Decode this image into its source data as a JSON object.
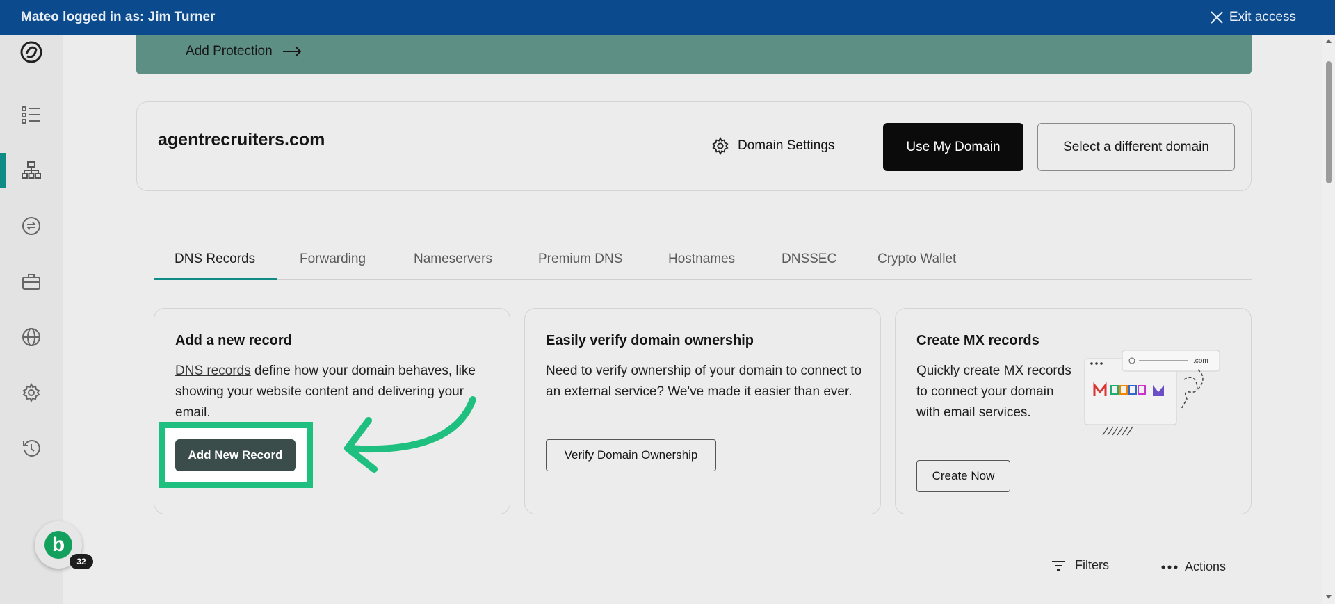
{
  "topbar": {
    "logged_in_text": "Mateo logged in as: Jim Turner",
    "exit_label": "Exit access"
  },
  "sidebar": {
    "items": [
      "logo-icon",
      "list-icon",
      "dns-icon",
      "transfer-icon",
      "briefcase-icon",
      "globe-icon",
      "gear-icon",
      "history-icon"
    ],
    "active": "dns-icon"
  },
  "banner": {
    "link_label": "Add Protection"
  },
  "domain": {
    "name": "agentrecruiters.com",
    "settings_label": "Domain Settings",
    "use_label": "Use My Domain",
    "select_label": "Select a different domain"
  },
  "tabs": [
    {
      "label": "DNS Records",
      "active": true
    },
    {
      "label": "Forwarding"
    },
    {
      "label": "Nameservers"
    },
    {
      "label": "Premium DNS"
    },
    {
      "label": "Hostnames"
    },
    {
      "label": "DNSSEC"
    },
    {
      "label": "Crypto Wallet"
    }
  ],
  "cards": {
    "add_record": {
      "title": "Add a new record",
      "link_text": "DNS records",
      "body": " define how your domain behaves, like showing your website content and delivering your email.",
      "button": "Add New Record"
    },
    "verify": {
      "title": "Easily verify domain ownership",
      "body": "Need to verify ownership of your domain to connect to an external service? We've made it easier than ever.",
      "button": "Verify Domain Ownership"
    },
    "mx": {
      "title": "Create MX records",
      "body": "Quickly create MX records to connect your domain with email services.",
      "button": "Create Now",
      "illustration_text": ".com"
    }
  },
  "toolbar": {
    "filters_label": "Filters",
    "actions_label": "Actions"
  },
  "helper": {
    "avatar_letter": "b",
    "badge_count": "32"
  },
  "colors": {
    "topbar": "#0c4a8e",
    "accent": "#0f8c85",
    "highlight": "#1fbf80",
    "primary_button": "#0b0b0b"
  }
}
